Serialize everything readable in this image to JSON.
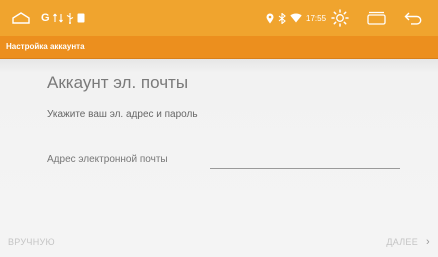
{
  "status_bar": {
    "background": "#f0a42e",
    "left_icons": [
      "home-icon",
      "google-icon",
      "network-icon",
      "usb-icon",
      "notification-icon"
    ],
    "right_icons": [
      "location-icon",
      "bluetooth-icon",
      "wifi-icon"
    ],
    "time": "17:55",
    "nav_icons": [
      "brightness-icon",
      "recent-apps-icon",
      "back-icon"
    ]
  },
  "toolbar": {
    "title": "Настройка аккаунта",
    "background": "#ec8f1e"
  },
  "main": {
    "heading": "Аккаунт эл. почты",
    "subheading": "Укажите ваш эл. адрес и пароль",
    "email_label": "Адрес электронной почты",
    "email_value": ""
  },
  "footer": {
    "manual_label": "ВРУЧНУЮ",
    "next_label": "ДАЛЕЕ",
    "next_icon": "chevron-right-icon"
  }
}
